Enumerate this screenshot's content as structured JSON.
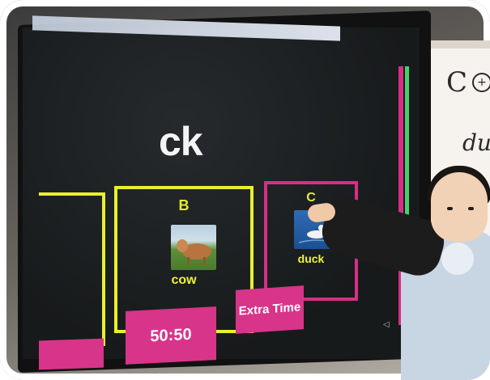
{
  "scene": {
    "screen": {
      "title": "ck",
      "cards": [
        {
          "letter": "",
          "word": ""
        },
        {
          "letter": "B",
          "word": "cow",
          "image": "cow-photo"
        },
        {
          "letter": "C",
          "word": "duck",
          "image": "duck-photo"
        }
      ],
      "buttons": {
        "partial_label": "",
        "fifty_fifty_label": "50:50",
        "extra_time_label": "Extra Time"
      },
      "accent_colors": {
        "yellow": "#e9ef2d",
        "pink": "#d8348a",
        "green": "#46d06b"
      }
    },
    "whiteboard": {
      "text_top": "C",
      "text_middle": "du"
    }
  }
}
